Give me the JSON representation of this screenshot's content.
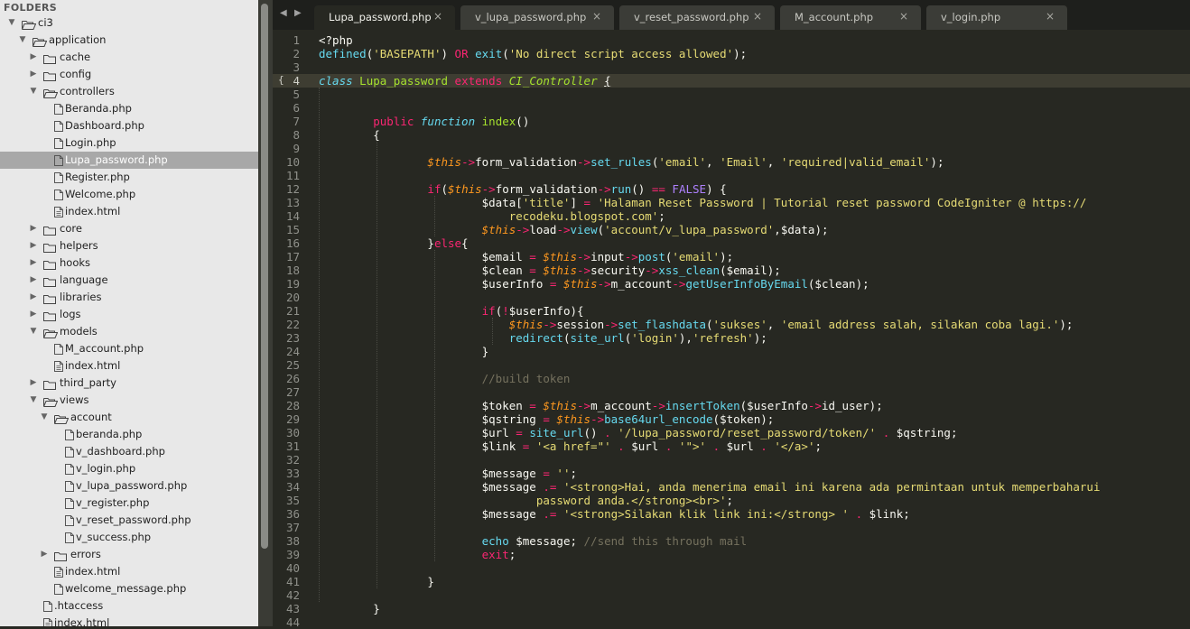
{
  "sidebar": {
    "title": "FOLDERS",
    "items": [
      {
        "label": "ci3",
        "type": "folder",
        "depth": 0,
        "open": true
      },
      {
        "label": "application",
        "type": "folder",
        "depth": 1,
        "open": true
      },
      {
        "label": "cache",
        "type": "folder",
        "depth": 2,
        "open": false
      },
      {
        "label": "config",
        "type": "folder",
        "depth": 2,
        "open": false
      },
      {
        "label": "controllers",
        "type": "folder",
        "depth": 2,
        "open": true
      },
      {
        "label": "Beranda.php",
        "type": "file",
        "depth": 3
      },
      {
        "label": "Dashboard.php",
        "type": "file",
        "depth": 3
      },
      {
        "label": "Login.php",
        "type": "file",
        "depth": 3
      },
      {
        "label": "Lupa_password.php",
        "type": "file",
        "depth": 3,
        "selected": true
      },
      {
        "label": "Register.php",
        "type": "file",
        "depth": 3
      },
      {
        "label": "Welcome.php",
        "type": "file",
        "depth": 3
      },
      {
        "label": "index.html",
        "type": "file",
        "depth": 3
      },
      {
        "label": "core",
        "type": "folder",
        "depth": 2,
        "open": false
      },
      {
        "label": "helpers",
        "type": "folder",
        "depth": 2,
        "open": false
      },
      {
        "label": "hooks",
        "type": "folder",
        "depth": 2,
        "open": false
      },
      {
        "label": "language",
        "type": "folder",
        "depth": 2,
        "open": false
      },
      {
        "label": "libraries",
        "type": "folder",
        "depth": 2,
        "open": false
      },
      {
        "label": "logs",
        "type": "folder",
        "depth": 2,
        "open": false
      },
      {
        "label": "models",
        "type": "folder",
        "depth": 2,
        "open": true
      },
      {
        "label": "M_account.php",
        "type": "file",
        "depth": 3
      },
      {
        "label": "index.html",
        "type": "file",
        "depth": 3
      },
      {
        "label": "third_party",
        "type": "folder",
        "depth": 2,
        "open": false
      },
      {
        "label": "views",
        "type": "folder",
        "depth": 2,
        "open": true
      },
      {
        "label": "account",
        "type": "folder",
        "depth": 3,
        "open": true
      },
      {
        "label": "beranda.php",
        "type": "file",
        "depth": 4
      },
      {
        "label": "v_dashboard.php",
        "type": "file",
        "depth": 4
      },
      {
        "label": "v_login.php",
        "type": "file",
        "depth": 4
      },
      {
        "label": "v_lupa_password.php",
        "type": "file",
        "depth": 4
      },
      {
        "label": "v_register.php",
        "type": "file",
        "depth": 4
      },
      {
        "label": "v_reset_password.php",
        "type": "file",
        "depth": 4
      },
      {
        "label": "v_success.php",
        "type": "file",
        "depth": 4
      },
      {
        "label": "errors",
        "type": "folder",
        "depth": 3,
        "open": false
      },
      {
        "label": "index.html",
        "type": "file",
        "depth": 3
      },
      {
        "label": "welcome_message.php",
        "type": "file",
        "depth": 3
      },
      {
        "label": ".htaccess",
        "type": "file",
        "depth": 2
      },
      {
        "label": "index.html",
        "type": "file",
        "depth": 2
      }
    ]
  },
  "tabs": [
    {
      "label": "Lupa_password.php",
      "active": true,
      "close": "×"
    },
    {
      "label": "v_lupa_password.php",
      "active": false,
      "close": "×"
    },
    {
      "label": "v_reset_password.php",
      "active": false,
      "close": "×"
    },
    {
      "label": "M_account.php",
      "active": false,
      "close": "×"
    },
    {
      "label": "v_login.php",
      "active": false,
      "close": "×"
    }
  ],
  "tab_nav": {
    "left": "◀",
    "right": "▶"
  },
  "editor": {
    "current_line": 4,
    "fold_marker": "{",
    "lines": [
      [
        [
          "p",
          "<?php"
        ]
      ],
      [
        [
          "f",
          "defined"
        ],
        [
          "p",
          "("
        ],
        [
          "s",
          "'BASEPATH'"
        ],
        [
          "p",
          ") "
        ],
        [
          "k",
          "OR"
        ],
        [
          "p",
          " "
        ],
        [
          "f",
          "exit"
        ],
        [
          "p",
          "("
        ],
        [
          "s",
          "'No direct script access allowed'"
        ],
        [
          "p",
          ");"
        ]
      ],
      [],
      [
        [
          "st",
          "class"
        ],
        [
          "p",
          " "
        ],
        [
          "n",
          "Lupa_password"
        ],
        [
          "p",
          " "
        ],
        [
          "k",
          "extends"
        ],
        [
          "p",
          " "
        ],
        [
          "ni",
          "CI_Controller"
        ],
        [
          "p",
          " "
        ],
        [
          "u",
          "{"
        ]
      ],
      [],
      [],
      [
        [
          "p",
          "        "
        ],
        [
          "k",
          "public"
        ],
        [
          "p",
          " "
        ],
        [
          "st",
          "function"
        ],
        [
          "p",
          " "
        ],
        [
          "n",
          "index"
        ],
        [
          "p",
          "()"
        ]
      ],
      [
        [
          "p",
          "        {"
        ]
      ],
      [],
      [
        [
          "p",
          "                "
        ],
        [
          "v",
          "$this"
        ],
        [
          "k",
          "->"
        ],
        [
          "p",
          "form_validation"
        ],
        [
          "k",
          "->"
        ],
        [
          "f",
          "set_rules"
        ],
        [
          "p",
          "("
        ],
        [
          "s",
          "'email'"
        ],
        [
          "p",
          ", "
        ],
        [
          "s",
          "'Email'"
        ],
        [
          "p",
          ", "
        ],
        [
          "s",
          "'required|valid_email'"
        ],
        [
          "p",
          ");"
        ]
      ],
      [],
      [
        [
          "p",
          "                "
        ],
        [
          "k",
          "if"
        ],
        [
          "p",
          "("
        ],
        [
          "v",
          "$this"
        ],
        [
          "k",
          "->"
        ],
        [
          "p",
          "form_validation"
        ],
        [
          "k",
          "->"
        ],
        [
          "f",
          "run"
        ],
        [
          "p",
          "() "
        ],
        [
          "k",
          "=="
        ],
        [
          "p",
          " "
        ],
        [
          "cn",
          "FALSE"
        ],
        [
          "p",
          ") {"
        ]
      ],
      [
        [
          "p",
          "                        $data["
        ],
        [
          "s",
          "'title'"
        ],
        [
          "p",
          "] "
        ],
        [
          "k",
          "="
        ],
        [
          "p",
          " "
        ],
        [
          "s",
          "'Halaman Reset Password | Tutorial reset password CodeIgniter @ https://"
        ]
      ],
      [
        [
          "s",
          "                            recodeku.blogspot.com'"
        ],
        [
          "p",
          ";"
        ]
      ],
      [
        [
          "p",
          "                        "
        ],
        [
          "v",
          "$this"
        ],
        [
          "k",
          "->"
        ],
        [
          "p",
          "load"
        ],
        [
          "k",
          "->"
        ],
        [
          "f",
          "view"
        ],
        [
          "p",
          "("
        ],
        [
          "s",
          "'account/v_lupa_password'"
        ],
        [
          "p",
          ",$data);"
        ]
      ],
      [
        [
          "p",
          "                }"
        ],
        [
          "k",
          "else"
        ],
        [
          "p",
          "{"
        ]
      ],
      [
        [
          "p",
          "                        $email "
        ],
        [
          "k",
          "="
        ],
        [
          "p",
          " "
        ],
        [
          "v",
          "$this"
        ],
        [
          "k",
          "->"
        ],
        [
          "p",
          "input"
        ],
        [
          "k",
          "->"
        ],
        [
          "f",
          "post"
        ],
        [
          "p",
          "("
        ],
        [
          "s",
          "'email'"
        ],
        [
          "p",
          ");"
        ]
      ],
      [
        [
          "p",
          "                        $clean "
        ],
        [
          "k",
          "="
        ],
        [
          "p",
          " "
        ],
        [
          "v",
          "$this"
        ],
        [
          "k",
          "->"
        ],
        [
          "p",
          "security"
        ],
        [
          "k",
          "->"
        ],
        [
          "f",
          "xss_clean"
        ],
        [
          "p",
          "($email);"
        ]
      ],
      [
        [
          "p",
          "                        $userInfo "
        ],
        [
          "k",
          "="
        ],
        [
          "p",
          " "
        ],
        [
          "v",
          "$this"
        ],
        [
          "k",
          "->"
        ],
        [
          "p",
          "m_account"
        ],
        [
          "k",
          "->"
        ],
        [
          "f",
          "getUserInfoByEmail"
        ],
        [
          "p",
          "($clean);"
        ]
      ],
      [],
      [
        [
          "p",
          "                        "
        ],
        [
          "k",
          "if"
        ],
        [
          "p",
          "("
        ],
        [
          "k",
          "!"
        ],
        [
          "p",
          "$userInfo){"
        ]
      ],
      [
        [
          "p",
          "                            "
        ],
        [
          "v",
          "$this"
        ],
        [
          "k",
          "->"
        ],
        [
          "p",
          "session"
        ],
        [
          "k",
          "->"
        ],
        [
          "f",
          "set_flashdata"
        ],
        [
          "p",
          "("
        ],
        [
          "s",
          "'sukses'"
        ],
        [
          "p",
          ", "
        ],
        [
          "s",
          "'email address salah, silakan coba lagi.'"
        ],
        [
          "p",
          ");"
        ]
      ],
      [
        [
          "p",
          "                            "
        ],
        [
          "f",
          "redirect"
        ],
        [
          "p",
          "("
        ],
        [
          "f",
          "site_url"
        ],
        [
          "p",
          "("
        ],
        [
          "s",
          "'login'"
        ],
        [
          "p",
          "),"
        ],
        [
          "s",
          "'refresh'"
        ],
        [
          "p",
          ");"
        ]
      ],
      [
        [
          "p",
          "                        }"
        ]
      ],
      [],
      [
        [
          "c",
          "                        //build token"
        ]
      ],
      [],
      [
        [
          "p",
          "                        $token "
        ],
        [
          "k",
          "="
        ],
        [
          "p",
          " "
        ],
        [
          "v",
          "$this"
        ],
        [
          "k",
          "->"
        ],
        [
          "p",
          "m_account"
        ],
        [
          "k",
          "->"
        ],
        [
          "f",
          "insertToken"
        ],
        [
          "p",
          "($userInfo"
        ],
        [
          "k",
          "->"
        ],
        [
          "p",
          "id_user);"
        ]
      ],
      [
        [
          "p",
          "                        $qstring "
        ],
        [
          "k",
          "="
        ],
        [
          "p",
          " "
        ],
        [
          "v",
          "$this"
        ],
        [
          "k",
          "->"
        ],
        [
          "f",
          "base64url_encode"
        ],
        [
          "p",
          "($token);"
        ]
      ],
      [
        [
          "p",
          "                        $url "
        ],
        [
          "k",
          "="
        ],
        [
          "p",
          " "
        ],
        [
          "f",
          "site_url"
        ],
        [
          "p",
          "() "
        ],
        [
          "k",
          "."
        ],
        [
          "p",
          " "
        ],
        [
          "s",
          "'/lupa_password/reset_password/token/'"
        ],
        [
          "p",
          " "
        ],
        [
          "k",
          "."
        ],
        [
          "p",
          " $qstring;"
        ]
      ],
      [
        [
          "p",
          "                        $link "
        ],
        [
          "k",
          "="
        ],
        [
          "p",
          " "
        ],
        [
          "s",
          "'<a href=\"'"
        ],
        [
          "p",
          " "
        ],
        [
          "k",
          "."
        ],
        [
          "p",
          " $url "
        ],
        [
          "k",
          "."
        ],
        [
          "p",
          " "
        ],
        [
          "s",
          "'\">'"
        ],
        [
          "p",
          " "
        ],
        [
          "k",
          "."
        ],
        [
          "p",
          " $url "
        ],
        [
          "k",
          "."
        ],
        [
          "p",
          " "
        ],
        [
          "s",
          "'</a>'"
        ],
        [
          "p",
          ";"
        ]
      ],
      [],
      [
        [
          "p",
          "                        $message "
        ],
        [
          "k",
          "="
        ],
        [
          "p",
          " "
        ],
        [
          "s",
          "''"
        ],
        [
          "p",
          ";"
        ]
      ],
      [
        [
          "p",
          "                        $message "
        ],
        [
          "k",
          ".="
        ],
        [
          "p",
          " "
        ],
        [
          "s",
          "'<strong>Hai, anda menerima email ini karena ada permintaan untuk memperbaharui"
        ]
      ],
      [
        [
          "s",
          "                                password anda.</strong><br>'"
        ],
        [
          "p",
          ";"
        ]
      ],
      [
        [
          "p",
          "                        $message "
        ],
        [
          "k",
          ".="
        ],
        [
          "p",
          " "
        ],
        [
          "s",
          "'<strong>Silakan klik link ini:</strong> '"
        ],
        [
          "p",
          " "
        ],
        [
          "k",
          "."
        ],
        [
          "p",
          " $link;"
        ]
      ],
      [],
      [
        [
          "p",
          "                        "
        ],
        [
          "f",
          "echo"
        ],
        [
          "p",
          " $message; "
        ],
        [
          "c",
          "//send this through mail"
        ]
      ],
      [
        [
          "p",
          "                        "
        ],
        [
          "k",
          "exit"
        ],
        [
          "p",
          ";"
        ]
      ],
      [],
      [
        [
          "p",
          "                }"
        ]
      ],
      [],
      [
        [
          "p",
          "        }"
        ]
      ],
      []
    ]
  }
}
